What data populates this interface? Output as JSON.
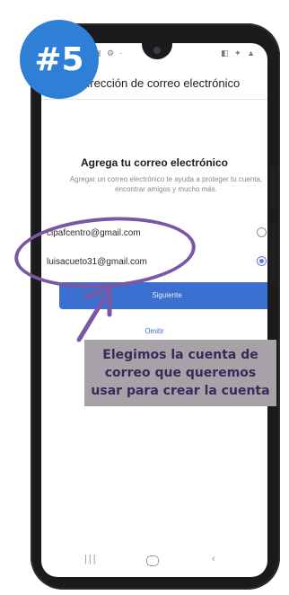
{
  "step_badge": "#5",
  "screen": {
    "title": "Dirección de correo electrónico",
    "heading": "Agrega tu correo electrónico",
    "description": "Agregar un correo electrónico te ayuda a proteger tu cuenta, encontrar amigos y mucho más.",
    "accounts": [
      {
        "email": "cipafcentro@gmail.com",
        "selected": false
      },
      {
        "email": "luisacueto31@gmail.com",
        "selected": true
      }
    ],
    "next_label": "Siguiente",
    "skip_label": "Omitir"
  },
  "caption": "Elegimos la cuenta de correo que queremos usar para crear la cuenta",
  "colors": {
    "badge": "#2f7fd6",
    "button": "#3b6fd0",
    "highlight": "#7a56a5",
    "caption_bg": "#a7a2a8"
  }
}
